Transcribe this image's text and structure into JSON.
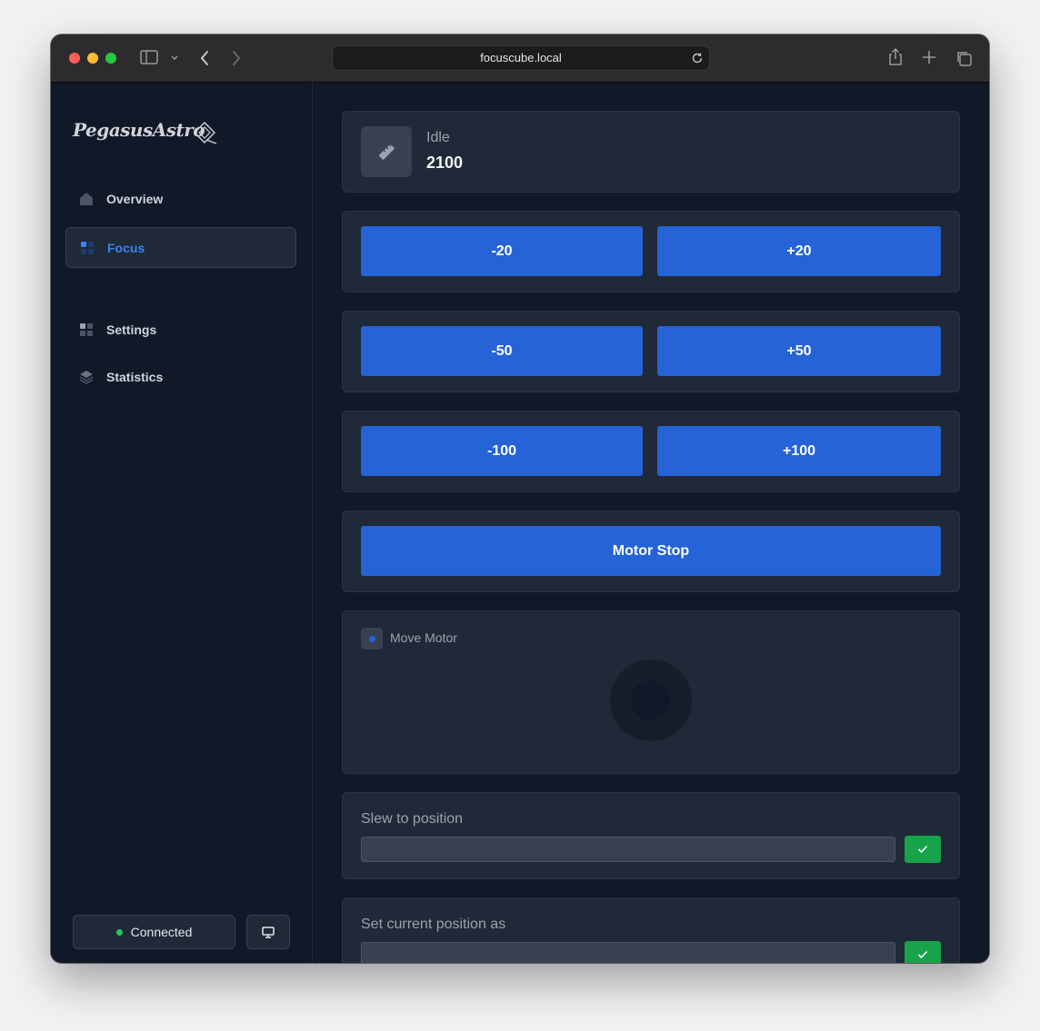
{
  "browser": {
    "url": "focuscube.local"
  },
  "sidebar": {
    "logo_text": "PegasusAstro",
    "items": [
      {
        "label": "Overview",
        "icon": "home-icon"
      },
      {
        "label": "Focus",
        "icon": "grid-icon",
        "active": true
      },
      {
        "label": "Settings",
        "icon": "grid-icon"
      },
      {
        "label": "Statistics",
        "icon": "layers-icon"
      }
    ],
    "connection": {
      "label": "Connected",
      "status_color": "#22c55e"
    },
    "monitor_icon": "monitor-icon"
  },
  "main": {
    "status": {
      "label": "Idle",
      "value": "2100",
      "icon": "ruler-icon"
    },
    "steps": [
      {
        "minus": "-20",
        "plus": "+20"
      },
      {
        "minus": "-50",
        "plus": "+50"
      },
      {
        "minus": "-100",
        "plus": "+100"
      }
    ],
    "motor_stop_label": "Motor Stop",
    "move_motor": {
      "label": "Move Motor"
    },
    "slew": {
      "label": "Slew to position",
      "value": ""
    },
    "set_position": {
      "label": "Set current position as",
      "value": ""
    }
  },
  "colors": {
    "accent": "#2563d6",
    "active_text": "#3b82f6",
    "confirm": "#16a34a",
    "panel": "#1f2937",
    "background": "#111827"
  }
}
